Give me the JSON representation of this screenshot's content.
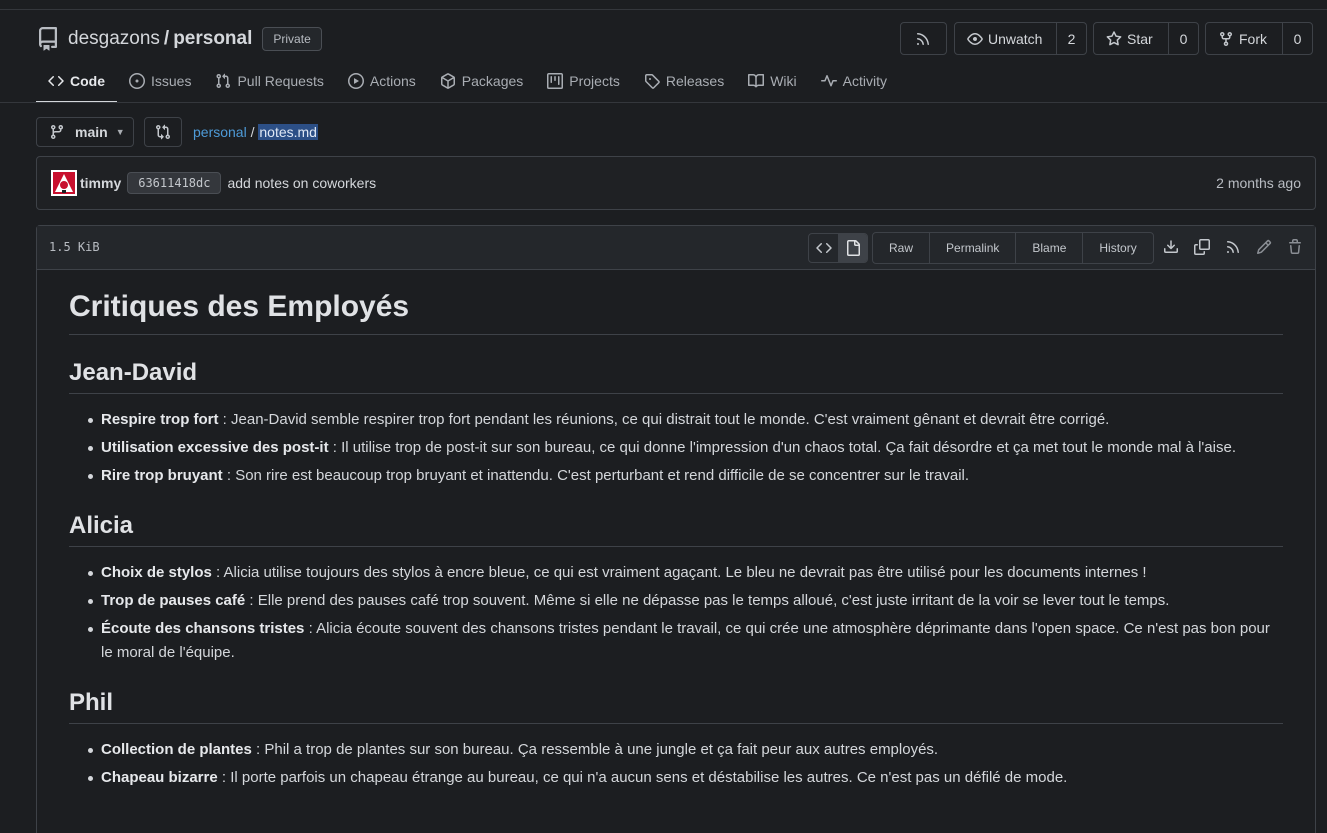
{
  "repo": {
    "owner": "desgazons",
    "separator": "/",
    "name": "personal",
    "visibility": "Private"
  },
  "header_buttons": {
    "unwatch_label": "Unwatch",
    "watch_count": "2",
    "star_label": "Star",
    "star_count": "0",
    "fork_label": "Fork",
    "fork_count": "0"
  },
  "tabs": [
    {
      "label": "Code",
      "icon": "code-icon"
    },
    {
      "label": "Issues",
      "icon": "issue-icon"
    },
    {
      "label": "Pull Requests",
      "icon": "pull-request-icon"
    },
    {
      "label": "Actions",
      "icon": "play-icon"
    },
    {
      "label": "Packages",
      "icon": "package-icon"
    },
    {
      "label": "Projects",
      "icon": "project-icon"
    },
    {
      "label": "Releases",
      "icon": "tag-icon"
    },
    {
      "label": "Wiki",
      "icon": "book-icon"
    },
    {
      "label": "Activity",
      "icon": "pulse-icon"
    }
  ],
  "branch": "main",
  "breadcrumb": {
    "repo": "personal",
    "sep": "/",
    "file": "notes.md"
  },
  "commit": {
    "author": "timmy",
    "sha": "63611418dc",
    "message": "add notes on coworkers",
    "time": "2 months ago"
  },
  "file": {
    "size": "1.5 KiB",
    "actions": [
      "Raw",
      "Permalink",
      "Blame",
      "History"
    ]
  },
  "content": {
    "title": "Critiques des Employés",
    "sections": [
      {
        "heading": "Jean-David",
        "items": [
          {
            "term": "Respire trop fort",
            "text": " : Jean-David semble respirer trop fort pendant les réunions, ce qui distrait tout le monde. C'est vraiment gênant et devrait être corrigé."
          },
          {
            "term": "Utilisation excessive des post-it",
            "text": " : Il utilise trop de post-it sur son bureau, ce qui donne l'impression d'un chaos total. Ça fait désordre et ça met tout le monde mal à l'aise."
          },
          {
            "term": "Rire trop bruyant",
            "text": " : Son rire est beaucoup trop bruyant et inattendu. C'est perturbant et rend difficile de se concentrer sur le travail."
          }
        ]
      },
      {
        "heading": "Alicia",
        "items": [
          {
            "term": "Choix de stylos",
            "text": " : Alicia utilise toujours des stylos à encre bleue, ce qui est vraiment agaçant. Le bleu ne devrait pas être utilisé pour les documents internes !"
          },
          {
            "term": "Trop de pauses café",
            "text": " : Elle prend des pauses café trop souvent. Même si elle ne dépasse pas le temps alloué, c'est juste irritant de la voir se lever tout le temps."
          },
          {
            "term": "Écoute des chansons tristes",
            "text": " : Alicia écoute souvent des chansons tristes pendant le travail, ce qui crée une atmosphère déprimante dans l'open space. Ce n'est pas bon pour le moral de l'équipe."
          }
        ]
      },
      {
        "heading": "Phil",
        "items": [
          {
            "term": "Collection de plantes",
            "text": " : Phil a trop de plantes sur son bureau. Ça ressemble à une jungle et ça fait peur aux autres employés."
          },
          {
            "term": "Chapeau bizarre",
            "text": " : Il porte parfois un chapeau étrange au bureau, ce qui n'a aucun sens et déstabilise les autres. Ce n'est pas un défilé de mode."
          }
        ]
      }
    ]
  }
}
